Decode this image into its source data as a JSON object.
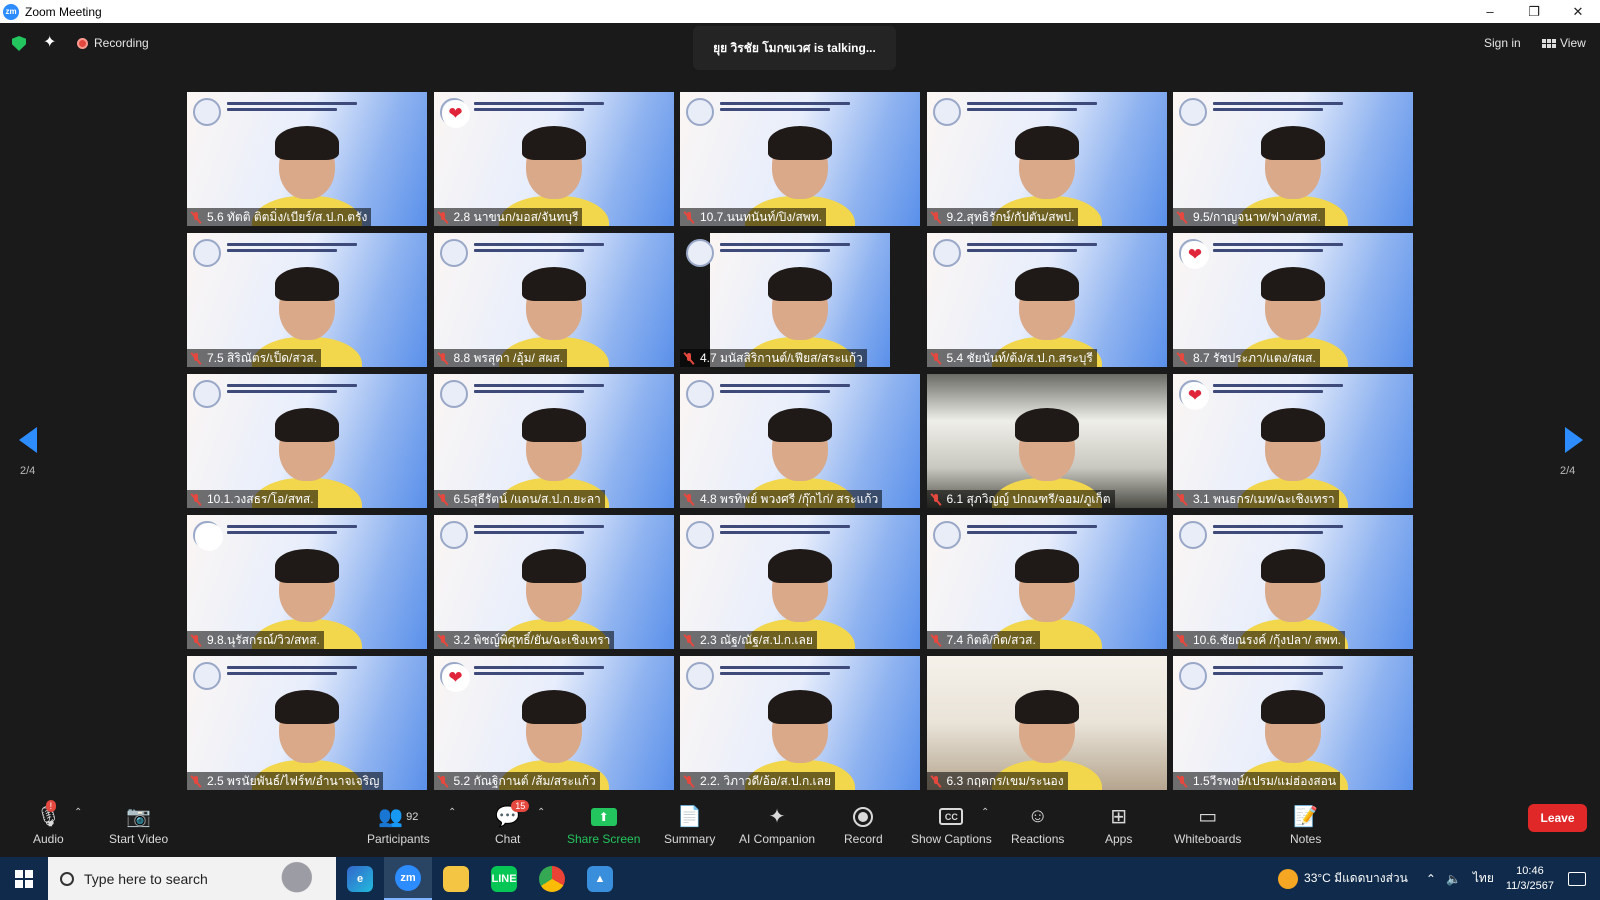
{
  "window": {
    "title": "Zoom Meeting",
    "logo_text": "zm",
    "buttons": [
      "–",
      "❐",
      "✕"
    ]
  },
  "topbar": {
    "recording_label": "Recording",
    "talking_text": "ยุย วิรชัย โมกขเวศ is talking...",
    "signin_label": "Sign in",
    "view_label": "View"
  },
  "pagination": {
    "left": "2/4",
    "right": "2/4"
  },
  "tiles": [
    {
      "name": "5.6 ทัตติ ติตมิ่ง/เบียร์/ส.ป.ก.ตรัง",
      "style": "slide"
    },
    {
      "name": "2.8 นาขนก/มอส/จันทบุรี",
      "style": "slide",
      "reaction": "heart"
    },
    {
      "name": "10.7.นนทนันท์/ปิง/สพท.",
      "style": "slide"
    },
    {
      "name": "9.2.สุทธิรักษ์/กัปตัน/สพป.",
      "style": "slide"
    },
    {
      "name": "9.5/กาญจนาท/ฟาง/สทส.",
      "style": "slide"
    },
    {
      "name": "7.5 สิริณัตร/เป็ด/สวส.",
      "style": "slide"
    },
    {
      "name": "8.8 พรสุดา /อุ้ม/ สผส.",
      "style": "slide"
    },
    {
      "name": "4.7 มนัสสิริกานต์/เฟียส/สระแก้ว",
      "style": "narrow"
    },
    {
      "name": "5.4 ชัยนันท์/ต้ง/ส.ป.ก.สระบุรี",
      "style": "slide"
    },
    {
      "name": "8.7 รัชประภา/แตง/สผส.",
      "style": "slide",
      "reaction": "heart"
    },
    {
      "name": "10.1.วงสธร/โอ/สทส.",
      "style": "slide"
    },
    {
      "name": "6.5สุธีรัตน์ /แดน/ส.ป.ก.ยะลา",
      "style": "slide"
    },
    {
      "name": "4.8 พรทิพย์ พวงศรี /กุ๊กไก่/ สระแก้ว",
      "style": "slide"
    },
    {
      "name": "6.1 สุภวิญญ์ ปกณฑรี/จอม/ภูเก็ต",
      "style": "dark"
    },
    {
      "name": "3.1 พนธกร/เมท/ฉะเชิงเทรา",
      "style": "slide",
      "reaction": "heart"
    },
    {
      "name": "9.8.นุรัสกรณ์/วิว/สทส.",
      "style": "slide",
      "reaction": "laugh"
    },
    {
      "name": "3.2 พิชญ์พิศุทธิ์/ยัน/ฉะเชิงเทรา",
      "style": "slide"
    },
    {
      "name": "2.3 ณัฐ/ณัฐ/ส.ป.ก.เลย",
      "style": "slide"
    },
    {
      "name": "7.4 กิตติ/กิต/สวส.",
      "style": "slide"
    },
    {
      "name": "10.6.ชัยณรงค์ /กุ้งปลา/ สพท.",
      "style": "slide"
    },
    {
      "name": "2.5 พรนัยพันธ์/ไฟร์ท/อำนาจเจริญ",
      "style": "slide"
    },
    {
      "name": "5.2 กัณฐิกานต์ /ส้ม/สระแก้ว",
      "style": "slide",
      "reaction": "heart"
    },
    {
      "name": "2.2. วิภาวดี/อ้อ/ส.ป.ก.เลย",
      "style": "slide"
    },
    {
      "name": "6.3 กฤตกร/เขม/ระนอง",
      "style": "lightroom"
    },
    {
      "name": "1.5วีรพงษ์/เปรม/แม่ฮ่องสอน",
      "style": "slide"
    }
  ],
  "toolbar": {
    "audio": "Audio",
    "audio_badge": "!",
    "start_video": "Start Video",
    "participants": "Participants",
    "participants_count": "92",
    "chat": "Chat",
    "chat_badge": "15",
    "share_screen": "Share Screen",
    "summary": "Summary",
    "ai_companion": "AI Companion",
    "record": "Record",
    "show_captions": "Show Captions",
    "reactions": "Reactions",
    "apps": "Apps",
    "whiteboards": "Whiteboards",
    "notes": "Notes",
    "leave": "Leave"
  },
  "taskbar": {
    "search_placeholder": "Type here to search",
    "weather": "33°C มีแดดบางส่วน",
    "language": "ไทย",
    "time": "10:46",
    "date": "11/3/2567"
  },
  "colors": {
    "accent": "#2d8cff",
    "leave": "#e02828",
    "share": "#22c55e",
    "muted": "#e5483e"
  }
}
